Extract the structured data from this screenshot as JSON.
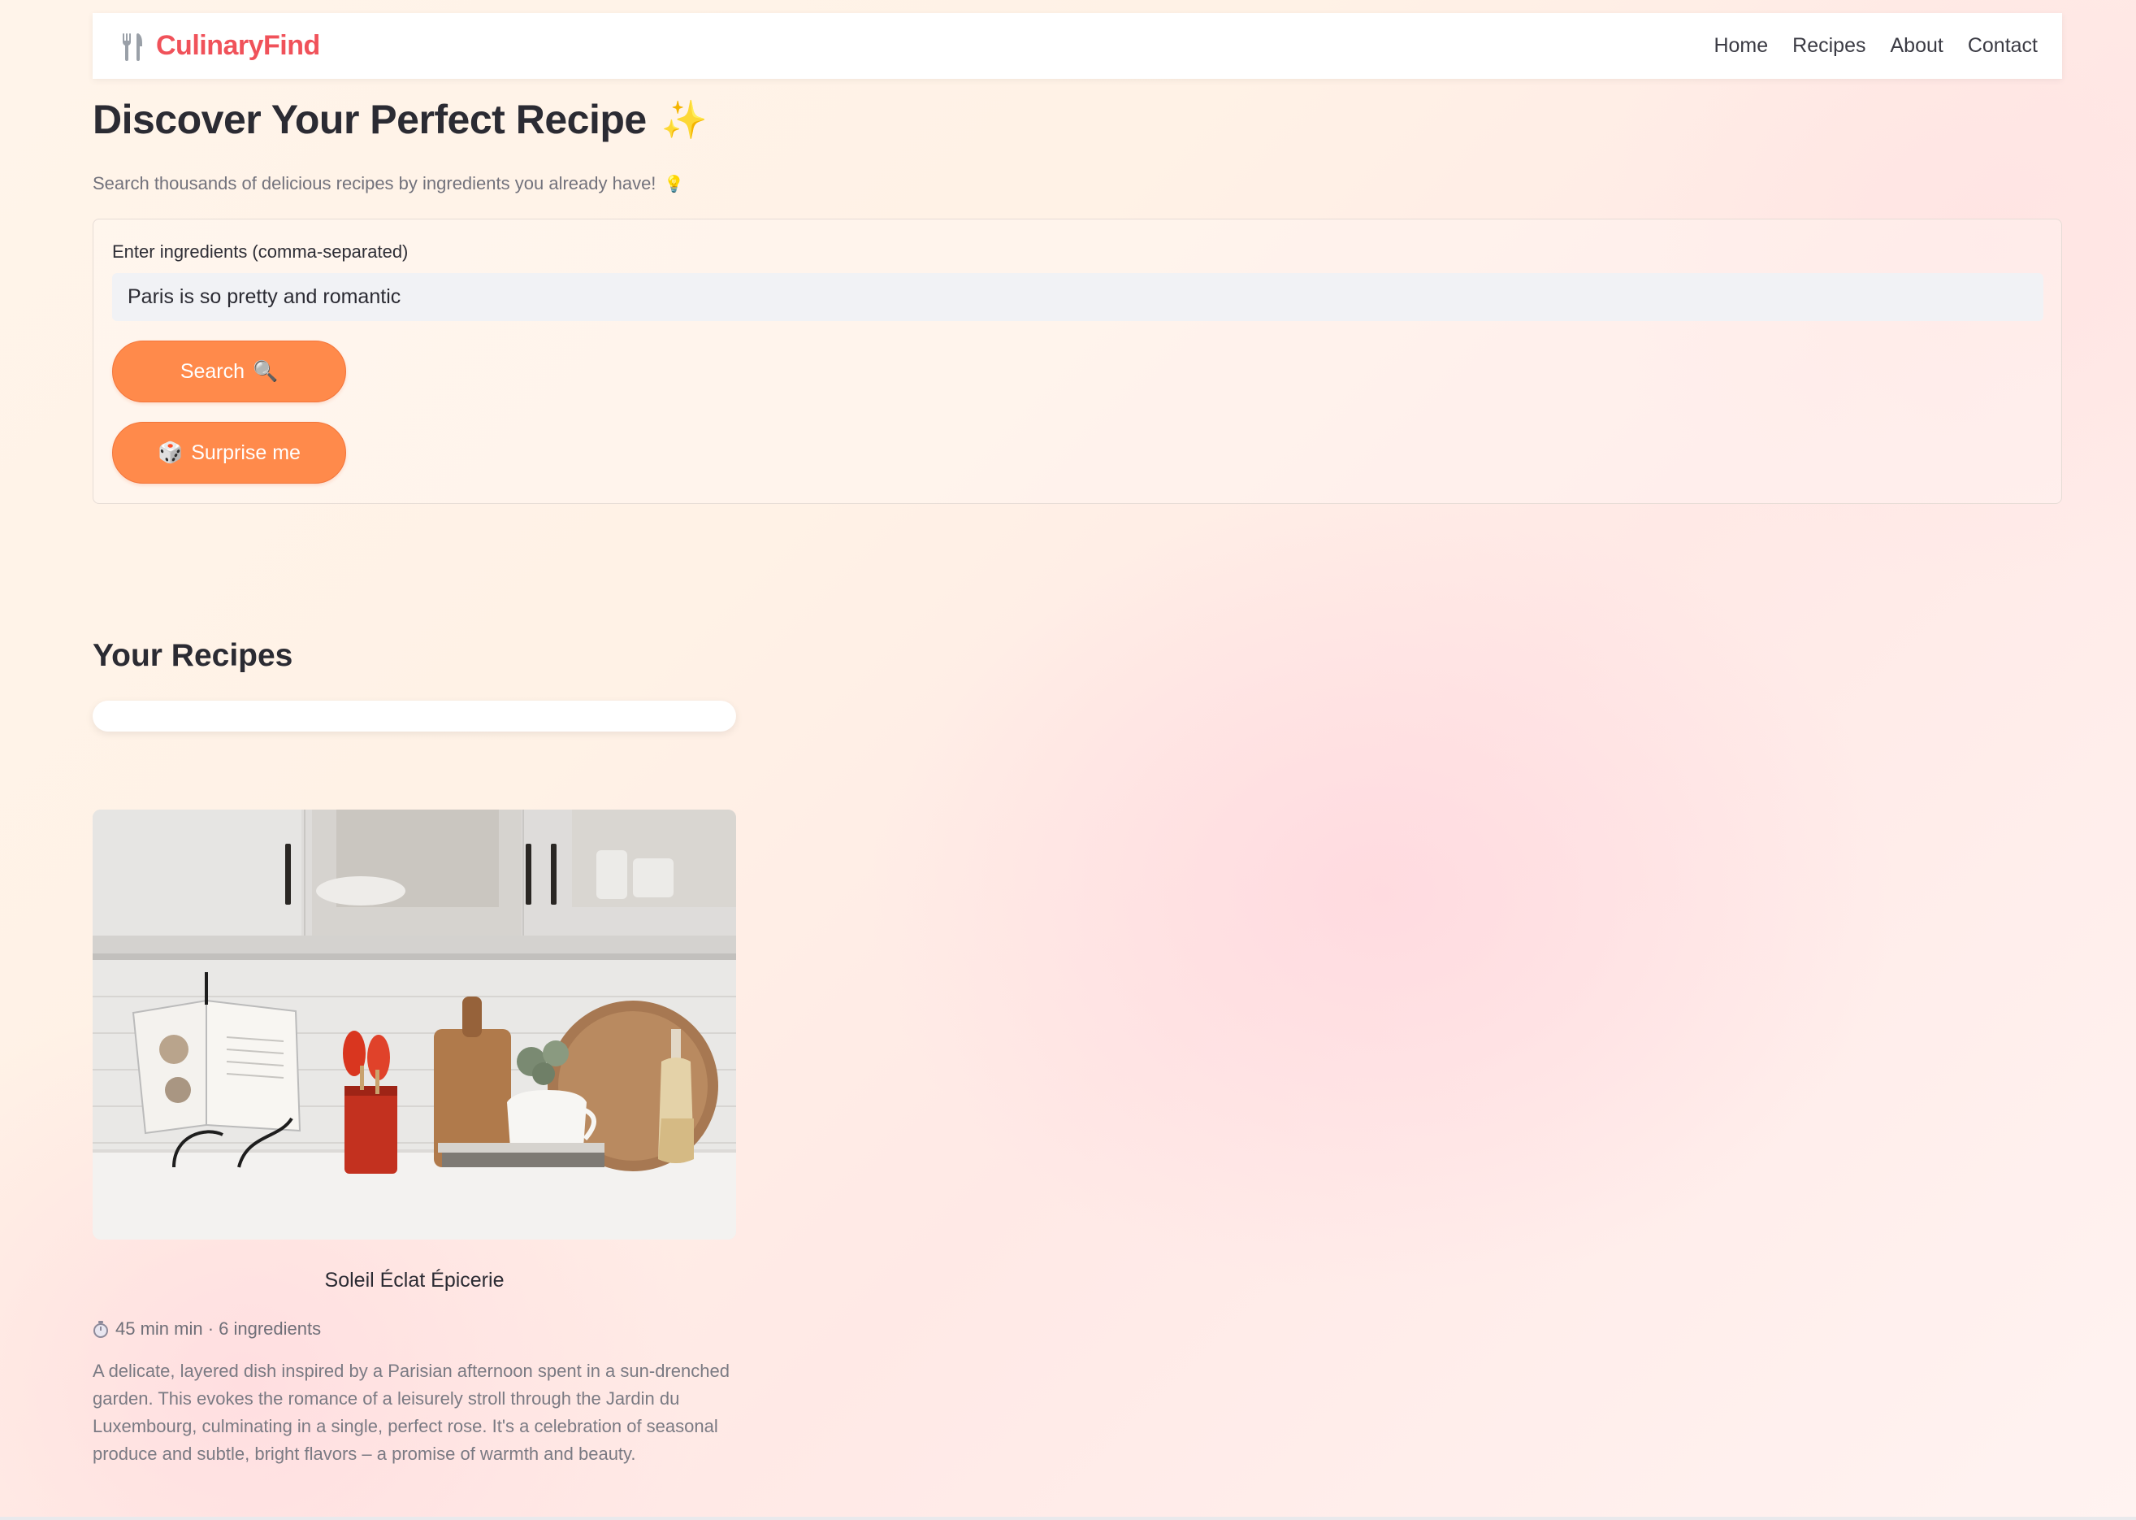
{
  "header": {
    "brand": "CulinaryFind",
    "brand_icon": "fork-knife-icon",
    "nav": [
      {
        "label": "Home"
      },
      {
        "label": "Recipes"
      },
      {
        "label": "About"
      },
      {
        "label": "Contact"
      }
    ]
  },
  "hero": {
    "title": "Discover Your Perfect Recipe",
    "title_emoji": "✨",
    "subtitle": "Search thousands of delicious recipes by ingredients you already have!",
    "subtitle_emoji": "💡"
  },
  "search": {
    "label": "Enter ingredients (comma-separated)",
    "value": "Paris is so pretty and romantic",
    "search_button": "Search",
    "search_button_icon": "🔍",
    "surprise_button": "Surprise me",
    "surprise_button_icon": "🎲"
  },
  "results": {
    "title": "Your Recipes",
    "recipes": [
      {
        "title": "Soleil Éclat Épicerie",
        "meta": "45 min min · 6 ingredients",
        "meta_icon": "timer-icon",
        "description": "A delicate, layered dish inspired by a Parisian afternoon spent in a sun-drenched garden. This evokes the romance of a leisurely stroll through the Jardin du Luxembourg, culminating in a single, perfect rose. It's a celebration of seasonal produce and subtle, bright flavors – a promise of warmth and beauty."
      }
    ]
  },
  "colors": {
    "brand": "#f0525a",
    "button": "#ff8a4b",
    "input_bg": "#f1f2f5"
  }
}
